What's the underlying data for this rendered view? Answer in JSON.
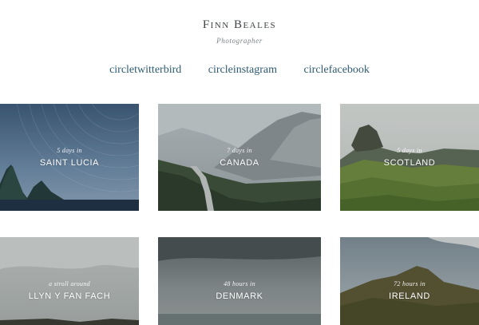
{
  "header": {
    "title": "Finn Beales",
    "subtitle": "Photographer",
    "social": [
      {
        "label": "circletwitterbird"
      },
      {
        "label": "circleinstagram"
      },
      {
        "label": "circlefacebook"
      }
    ]
  },
  "trips": [
    {
      "duration": "5 days in",
      "country": "SAINT LUCIA"
    },
    {
      "duration": "7 days in",
      "country": "CANADA"
    },
    {
      "duration": "5 days in",
      "country": "SCOTLAND"
    },
    {
      "duration": "a stroll around",
      "country": "LLYN Y FAN FACH"
    },
    {
      "duration": "48 hours in",
      "country": "DENMARK"
    },
    {
      "duration": "72 hours in",
      "country": "IRELAND"
    }
  ],
  "colors": {
    "title": "#3e4547",
    "link": "#2e5b72",
    "background": "#ffffff"
  }
}
